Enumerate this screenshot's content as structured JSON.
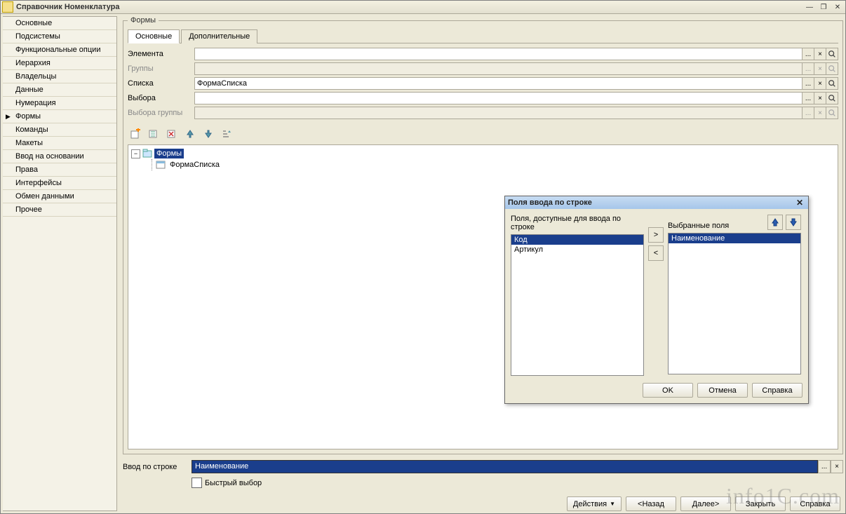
{
  "window": {
    "title": "Справочник Номенклатура"
  },
  "sidebar": {
    "items": [
      "Основные",
      "Подсистемы",
      "Функциональные опции",
      "Иерархия",
      "Владельцы",
      "Данные",
      "Нумерация",
      "Формы",
      "Команды",
      "Макеты",
      "Ввод на основании",
      "Права",
      "Интерфейсы",
      "Обмен данными",
      "Прочее"
    ],
    "selected_index": 7
  },
  "forms": {
    "legend": "Формы",
    "tabs": {
      "main": "Основные",
      "additional": "Дополнительные"
    },
    "rows": {
      "element": {
        "label": "Элемента",
        "value": "",
        "enabled": true
      },
      "group": {
        "label": "Группы",
        "value": "",
        "enabled": false
      },
      "list": {
        "label": "Списка",
        "value": "ФормаСписка",
        "enabled": true
      },
      "choice": {
        "label": "Выбора",
        "value": "",
        "enabled": true
      },
      "group_choice": {
        "label": "Выбора группы",
        "value": "",
        "enabled": false
      }
    },
    "field_btns": {
      "dots": "...",
      "clear": "×",
      "pick": "🔍"
    },
    "tree": {
      "root_label": "Формы",
      "child_label": "ФормаСписка"
    }
  },
  "bottom": {
    "input_by_string_label": "Ввод по строке",
    "input_by_string_value": "Наименование",
    "quick_choice_label": "Быстрый выбор",
    "btn_dots": "...",
    "btn_clear": "×"
  },
  "footer": {
    "actions": "Действия",
    "back": "<Назад",
    "next": "Далее>",
    "close": "Закрыть",
    "help": "Справка"
  },
  "dialog": {
    "title": "Поля ввода по строке",
    "available_label": "Поля, доступные для ввода по строке",
    "selected_label": "Выбранные поля",
    "available": [
      "Код",
      "Артикул"
    ],
    "available_sel_index": 0,
    "selected": [
      "Наименование"
    ],
    "selected_sel_index": 0,
    "btn_add": ">",
    "btn_remove": "<",
    "ok": "OK",
    "cancel": "Отмена",
    "help": "Справка"
  },
  "watermark": "info1C.com"
}
